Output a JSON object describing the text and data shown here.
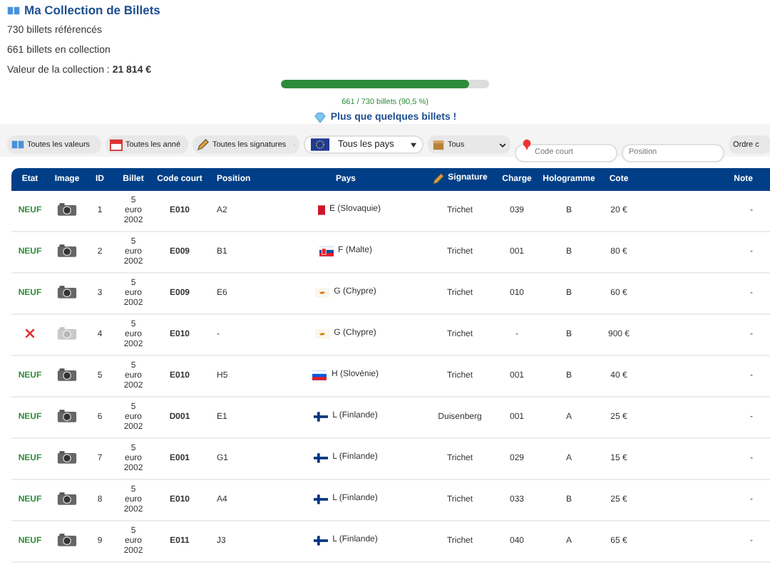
{
  "header": {
    "title": "Ma Collection de Billets",
    "stats": [
      "730 billets référencés",
      "661 billets en collection"
    ],
    "value_label": "Valeur de la collection : ",
    "value": "21 814 €"
  },
  "progress": {
    "level": 0.905,
    "reading": "661 / 730 billets (90,5 %)",
    "message": "Plus que quelques billets !"
  },
  "filters": [
    {
      "kind": "select",
      "label": "Toutes les valeurs"
    },
    {
      "kind": "select",
      "label": "Toutes les anné"
    },
    {
      "kind": "select",
      "label": "Toutes les signatures"
    },
    {
      "kind": "country",
      "label": "Tous les pays"
    },
    {
      "kind": "select",
      "label": "Tous"
    },
    {
      "kind": "input",
      "placeholder": "Code court"
    },
    {
      "kind": "input",
      "placeholder": "Position"
    },
    {
      "kind": "select",
      "label": "Ordre c"
    }
  ],
  "table": {
    "columns": [
      "Etat",
      "Image",
      "ID",
      "Billet",
      "Code court",
      "Position",
      "Pays",
      "Signature",
      "Charge",
      "Hologramme",
      "Cote",
      "Note"
    ],
    "rows": [
      {
        "owned": true,
        "etat": "NEUF",
        "id": "1",
        "billet": "5 euro 2002",
        "code": "E010",
        "position": "A2",
        "pays": "E (Slovaquie)",
        "signature": "Trichet",
        "charge": "039",
        "hologramme": "B",
        "cote": "20 €",
        "note": "-"
      },
      {
        "owned": true,
        "etat": "NEUF",
        "id": "2",
        "billet": "5 euro 2002",
        "code": "E009",
        "position": "B1",
        "pays": "F (Malte)",
        "signature": "Trichet",
        "charge": "001",
        "hologramme": "B",
        "cote": "80 €",
        "note": "-"
      },
      {
        "owned": true,
        "etat": "NEUF",
        "id": "3",
        "billet": "5 euro 2002",
        "code": "E009",
        "position": "E6",
        "pays": "G (Chypre)",
        "signature": "Trichet",
        "charge": "010",
        "hologramme": "B",
        "cote": "60 €",
        "note": "-"
      },
      {
        "owned": false,
        "id": "4",
        "billet": "5 euro 2002",
        "code": "E010",
        "position": "-",
        "pays": "G (Chypre)",
        "signature": "Trichet",
        "charge": "-",
        "hologramme": "B",
        "cote": "900 €",
        "note": "-"
      },
      {
        "owned": true,
        "etat": "NEUF",
        "id": "5",
        "billet": "5 euro 2002",
        "code": "E010",
        "position": "H5",
        "pays": "H (Slovénie)",
        "signature": "Trichet",
        "charge": "001",
        "hologramme": "B",
        "cote": "40 €",
        "note": "-"
      },
      {
        "owned": true,
        "etat": "NEUF",
        "id": "6",
        "billet": "5 euro 2002",
        "code": "D001",
        "position": "E1",
        "pays": "L (Finlande)",
        "signature": "Duisenberg",
        "charge": "001",
        "hologramme": "A",
        "cote": "25 €",
        "note": "-"
      },
      {
        "owned": true,
        "etat": "NEUF",
        "id": "7",
        "billet": "5 euro 2002",
        "code": "E001",
        "position": "G1",
        "pays": "L (Finlande)",
        "signature": "Trichet",
        "charge": "029",
        "hologramme": "A",
        "cote": "15 €",
        "note": "-"
      },
      {
        "owned": true,
        "etat": "NEUF",
        "id": "8",
        "billet": "5 euro 2002",
        "code": "E010",
        "position": "A4",
        "pays": "L (Finlande)",
        "signature": "Trichet",
        "charge": "033",
        "hologramme": "B",
        "cote": "25 €",
        "note": "-"
      },
      {
        "owned": true,
        "etat": "NEUF",
        "id": "9",
        "billet": "5 euro 2002",
        "code": "E011",
        "position": "J3",
        "pays": "L (Finlande)",
        "signature": "Trichet",
        "charge": "040",
        "hologramme": "A",
        "cote": "65 €",
        "note": "-"
      }
    ]
  }
}
